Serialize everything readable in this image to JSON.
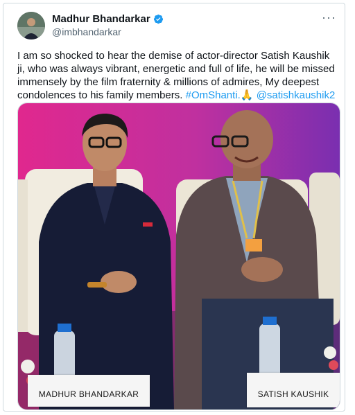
{
  "author": {
    "name": "Madhur Bhandarkar",
    "handle": "@imbhandarkar",
    "verified_icon": "verified-badge-icon",
    "badge_color": "#1d9bf0"
  },
  "tweet": {
    "text_main": "I am so shocked to hear the demise of actor-director Satish Kaushik ji, who was always vibrant, energetic and full of life, he will be missed immensely by the film fraternity & millions of admires, My deepest condolences to his family members.",
    "hashtag": "#OmShanti.",
    "emoji": "🙏",
    "mention": "@satishkaushik2"
  },
  "photo": {
    "left_nameplate": "MADHUR BHANDARKAR",
    "right_nameplate": "SATISH KAUSHIK"
  },
  "colors": {
    "link": "#1d9bf0",
    "backdrop_pink": "#e0288e",
    "backdrop_purple": "#7a2fb0"
  }
}
